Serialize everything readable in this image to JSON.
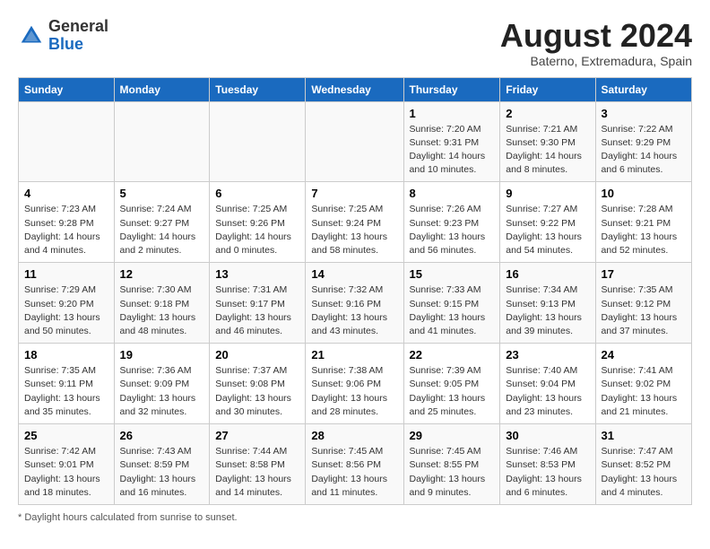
{
  "header": {
    "logo": {
      "general": "General",
      "blue": "Blue"
    },
    "month_year": "August 2024",
    "location": "Baterno, Extremadura, Spain"
  },
  "days_of_week": [
    "Sunday",
    "Monday",
    "Tuesday",
    "Wednesday",
    "Thursday",
    "Friday",
    "Saturday"
  ],
  "weeks": [
    [
      {
        "day": "",
        "info": ""
      },
      {
        "day": "",
        "info": ""
      },
      {
        "day": "",
        "info": ""
      },
      {
        "day": "",
        "info": ""
      },
      {
        "day": "1",
        "info": "Sunrise: 7:20 AM\nSunset: 9:31 PM\nDaylight: 14 hours\nand 10 minutes."
      },
      {
        "day": "2",
        "info": "Sunrise: 7:21 AM\nSunset: 9:30 PM\nDaylight: 14 hours\nand 8 minutes."
      },
      {
        "day": "3",
        "info": "Sunrise: 7:22 AM\nSunset: 9:29 PM\nDaylight: 14 hours\nand 6 minutes."
      }
    ],
    [
      {
        "day": "4",
        "info": "Sunrise: 7:23 AM\nSunset: 9:28 PM\nDaylight: 14 hours\nand 4 minutes."
      },
      {
        "day": "5",
        "info": "Sunrise: 7:24 AM\nSunset: 9:27 PM\nDaylight: 14 hours\nand 2 minutes."
      },
      {
        "day": "6",
        "info": "Sunrise: 7:25 AM\nSunset: 9:26 PM\nDaylight: 14 hours\nand 0 minutes."
      },
      {
        "day": "7",
        "info": "Sunrise: 7:25 AM\nSunset: 9:24 PM\nDaylight: 13 hours\nand 58 minutes."
      },
      {
        "day": "8",
        "info": "Sunrise: 7:26 AM\nSunset: 9:23 PM\nDaylight: 13 hours\nand 56 minutes."
      },
      {
        "day": "9",
        "info": "Sunrise: 7:27 AM\nSunset: 9:22 PM\nDaylight: 13 hours\nand 54 minutes."
      },
      {
        "day": "10",
        "info": "Sunrise: 7:28 AM\nSunset: 9:21 PM\nDaylight: 13 hours\nand 52 minutes."
      }
    ],
    [
      {
        "day": "11",
        "info": "Sunrise: 7:29 AM\nSunset: 9:20 PM\nDaylight: 13 hours\nand 50 minutes."
      },
      {
        "day": "12",
        "info": "Sunrise: 7:30 AM\nSunset: 9:18 PM\nDaylight: 13 hours\nand 48 minutes."
      },
      {
        "day": "13",
        "info": "Sunrise: 7:31 AM\nSunset: 9:17 PM\nDaylight: 13 hours\nand 46 minutes."
      },
      {
        "day": "14",
        "info": "Sunrise: 7:32 AM\nSunset: 9:16 PM\nDaylight: 13 hours\nand 43 minutes."
      },
      {
        "day": "15",
        "info": "Sunrise: 7:33 AM\nSunset: 9:15 PM\nDaylight: 13 hours\nand 41 minutes."
      },
      {
        "day": "16",
        "info": "Sunrise: 7:34 AM\nSunset: 9:13 PM\nDaylight: 13 hours\nand 39 minutes."
      },
      {
        "day": "17",
        "info": "Sunrise: 7:35 AM\nSunset: 9:12 PM\nDaylight: 13 hours\nand 37 minutes."
      }
    ],
    [
      {
        "day": "18",
        "info": "Sunrise: 7:35 AM\nSunset: 9:11 PM\nDaylight: 13 hours\nand 35 minutes."
      },
      {
        "day": "19",
        "info": "Sunrise: 7:36 AM\nSunset: 9:09 PM\nDaylight: 13 hours\nand 32 minutes."
      },
      {
        "day": "20",
        "info": "Sunrise: 7:37 AM\nSunset: 9:08 PM\nDaylight: 13 hours\nand 30 minutes."
      },
      {
        "day": "21",
        "info": "Sunrise: 7:38 AM\nSunset: 9:06 PM\nDaylight: 13 hours\nand 28 minutes."
      },
      {
        "day": "22",
        "info": "Sunrise: 7:39 AM\nSunset: 9:05 PM\nDaylight: 13 hours\nand 25 minutes."
      },
      {
        "day": "23",
        "info": "Sunrise: 7:40 AM\nSunset: 9:04 PM\nDaylight: 13 hours\nand 23 minutes."
      },
      {
        "day": "24",
        "info": "Sunrise: 7:41 AM\nSunset: 9:02 PM\nDaylight: 13 hours\nand 21 minutes."
      }
    ],
    [
      {
        "day": "25",
        "info": "Sunrise: 7:42 AM\nSunset: 9:01 PM\nDaylight: 13 hours\nand 18 minutes."
      },
      {
        "day": "26",
        "info": "Sunrise: 7:43 AM\nSunset: 8:59 PM\nDaylight: 13 hours\nand 16 minutes."
      },
      {
        "day": "27",
        "info": "Sunrise: 7:44 AM\nSunset: 8:58 PM\nDaylight: 13 hours\nand 14 minutes."
      },
      {
        "day": "28",
        "info": "Sunrise: 7:45 AM\nSunset: 8:56 PM\nDaylight: 13 hours\nand 11 minutes."
      },
      {
        "day": "29",
        "info": "Sunrise: 7:45 AM\nSunset: 8:55 PM\nDaylight: 13 hours\nand 9 minutes."
      },
      {
        "day": "30",
        "info": "Sunrise: 7:46 AM\nSunset: 8:53 PM\nDaylight: 13 hours\nand 6 minutes."
      },
      {
        "day": "31",
        "info": "Sunrise: 7:47 AM\nSunset: 8:52 PM\nDaylight: 13 hours\nand 4 minutes."
      }
    ]
  ],
  "daylight_note": "Daylight hours"
}
